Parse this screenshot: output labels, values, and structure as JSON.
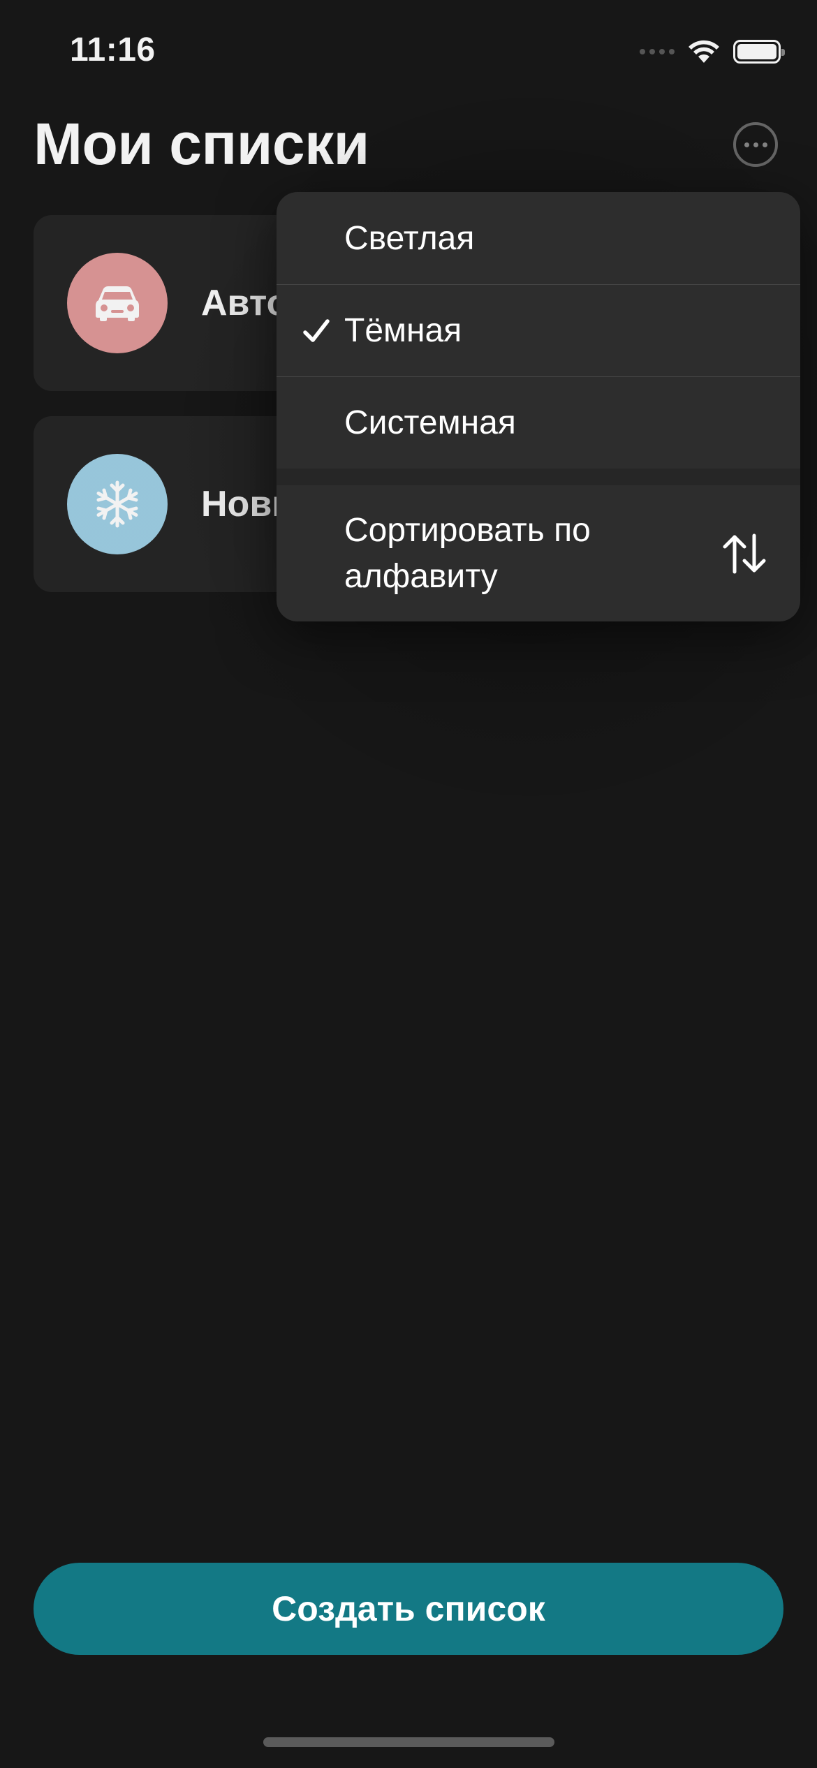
{
  "status_bar": {
    "time": "11:16"
  },
  "header": {
    "title": "Мои списки",
    "more_icon": "ellipsis-circle-icon"
  },
  "lists": [
    {
      "label": "Авто",
      "icon": "car-icon",
      "color": "#e29a9a"
    },
    {
      "label": "Новый",
      "icon": "snowflake-icon",
      "color": "#9fd0e6"
    }
  ],
  "menu": {
    "options": [
      {
        "label": "Светлая",
        "selected": false
      },
      {
        "label": "Тёмная",
        "selected": true
      },
      {
        "label": "Системная",
        "selected": false
      }
    ],
    "sort_label": "Сортировать по алфавиту",
    "sort_icon": "arrow-up-down-icon"
  },
  "bottom": {
    "create_label": "Создать список",
    "accent_color": "#137985"
  }
}
